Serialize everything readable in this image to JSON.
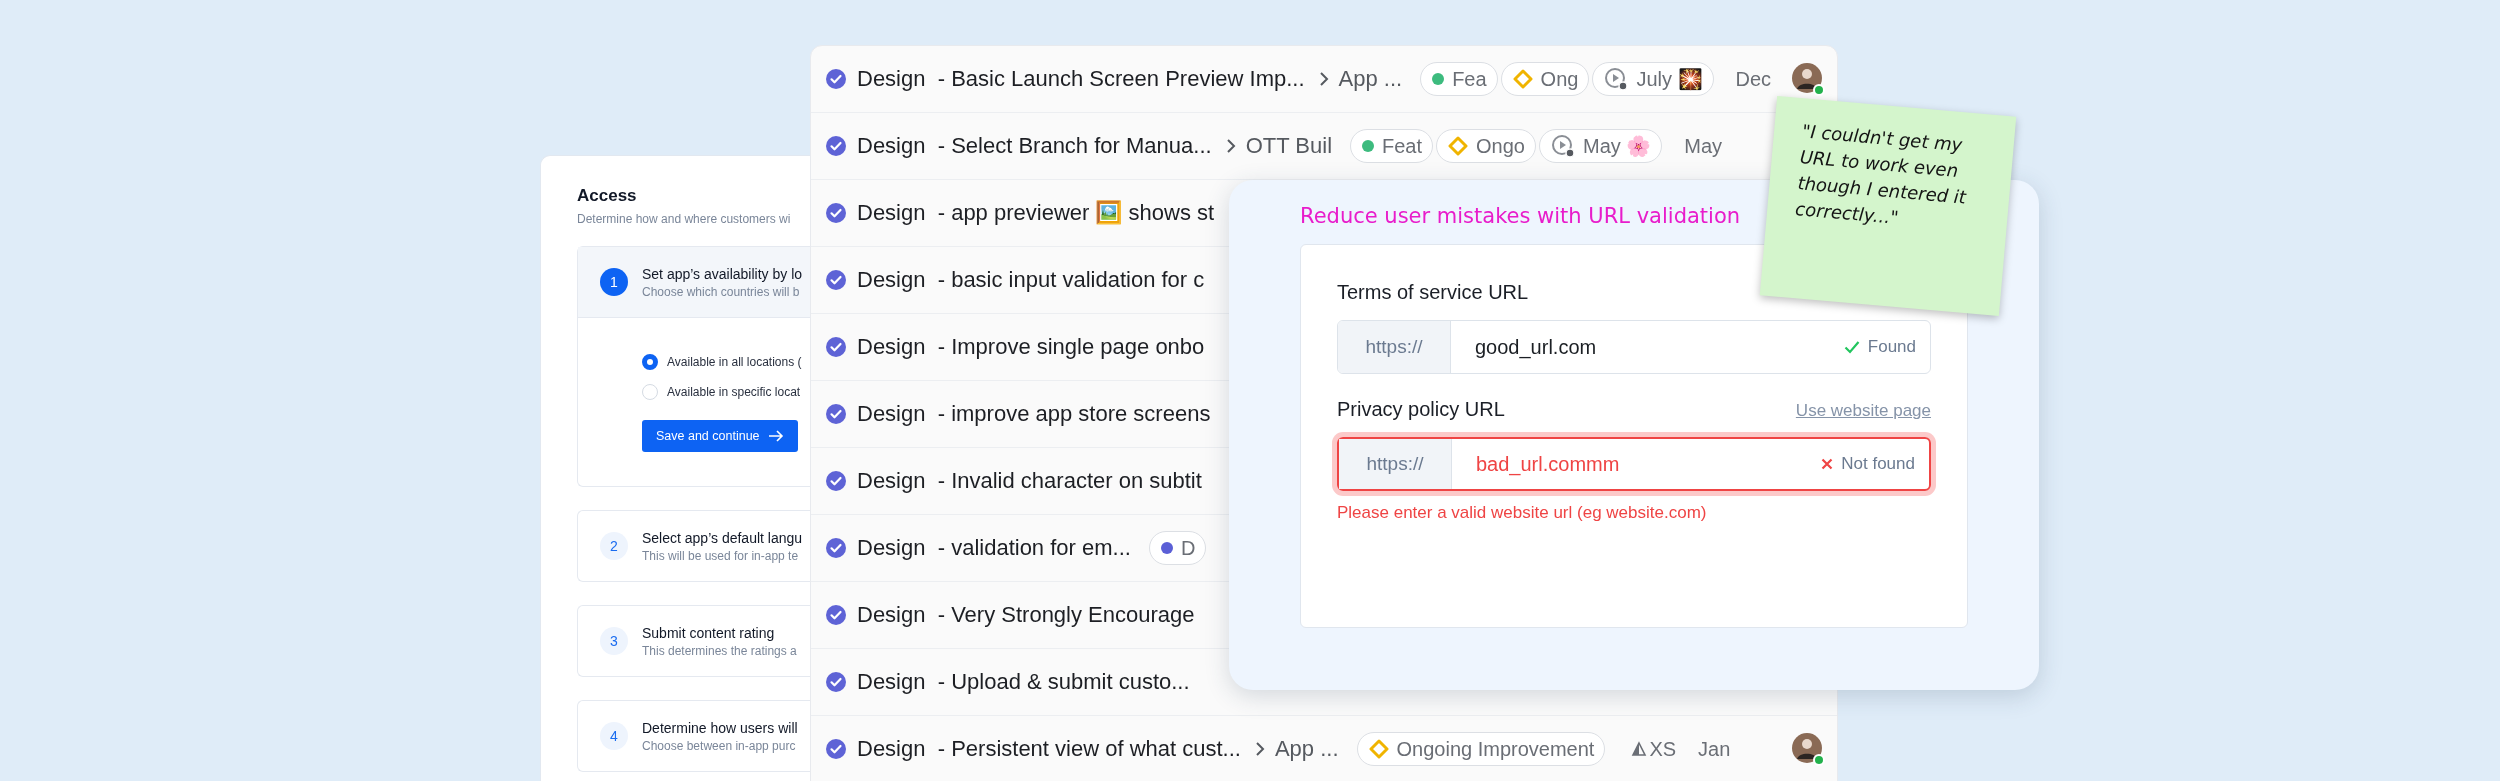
{
  "access_panel": {
    "title": "Access",
    "subtitle": "Determine how and where customers wi",
    "steps": [
      {
        "number": "1",
        "title": "Set app’s availability by lo",
        "subtitle": "Choose which countries will b",
        "expanded": true,
        "options": [
          {
            "label": "Available in all locations (",
            "selected": true
          },
          {
            "label": "Available in specific locat",
            "selected": false
          }
        ],
        "button": "Save and continue"
      },
      {
        "number": "2",
        "title": "Select app’s default langu",
        "subtitle": "This will be used for in-app te",
        "expanded": false
      },
      {
        "number": "3",
        "title": "Submit content rating",
        "subtitle": "This determines the ratings a",
        "expanded": false
      },
      {
        "number": "4",
        "title": "Determine how users will",
        "subtitle": "Choose between in-app purc",
        "expanded": false
      }
    ]
  },
  "tasks": [
    {
      "title": "Design  - Basic Launch Screen Preview Imp...",
      "done": true,
      "breadcrumb": "App ...",
      "pills": [
        {
          "kind": "dot",
          "color": "#3dbb7e",
          "label": "Fea"
        },
        {
          "kind": "diamond",
          "label": "Ong"
        },
        {
          "kind": "cycle",
          "label": "July 🎇"
        }
      ],
      "date": "Dec",
      "avatar": true
    },
    {
      "title": "Design  - Select Branch for Manua...",
      "done": true,
      "breadcrumb": "OTT Buil",
      "pills": [
        {
          "kind": "dot",
          "color": "#3dbb7e",
          "label": "Feat"
        },
        {
          "kind": "diamond",
          "label": "Ongo"
        },
        {
          "kind": "cycle",
          "label": "May 🌸"
        }
      ],
      "date": "May"
    },
    {
      "title": "Design  - app previewer 🖼️ shows st",
      "done": true
    },
    {
      "title": "Design  - basic input validation for c",
      "done": true
    },
    {
      "title": "Design  - Improve single page onbo",
      "done": true
    },
    {
      "title": "Design  - improve app store screens",
      "done": true
    },
    {
      "title": "Design  - Invalid character on subtit",
      "done": true
    },
    {
      "title": "Design  - validation for em...",
      "done": true,
      "pills": [
        {
          "kind": "dot",
          "color": "#5b5fd6",
          "label": "D"
        }
      ]
    },
    {
      "title": "Design  - Very Strongly Encourage",
      "done": true
    },
    {
      "title": "Design  - Upload & submit custo...",
      "done": true
    },
    {
      "title": "Design  - Persistent view of what cust...",
      "done": true,
      "breadcrumb": "App ...",
      "pills": [
        {
          "kind": "diamond",
          "label": "Ongoing Improvement"
        }
      ],
      "size": "XS",
      "date": "Jan",
      "avatar": true
    }
  ],
  "url_card": {
    "title": "Reduce user mistakes with URL validation",
    "fields": [
      {
        "label": "Terms of service URL",
        "prefix": "https://",
        "value": "good_url.com",
        "valid": true,
        "status_text": "Found"
      },
      {
        "label": "Privacy policy URL",
        "link": "Use website page",
        "prefix": "https://",
        "value": "bad_url.commm",
        "valid": false,
        "status_text": "Not found",
        "error": "Please enter a valid website url (eg website.com)"
      }
    ]
  },
  "sticky_note": {
    "text": "\"I couldn't get my URL to work even though I entered it correctly...\""
  }
}
